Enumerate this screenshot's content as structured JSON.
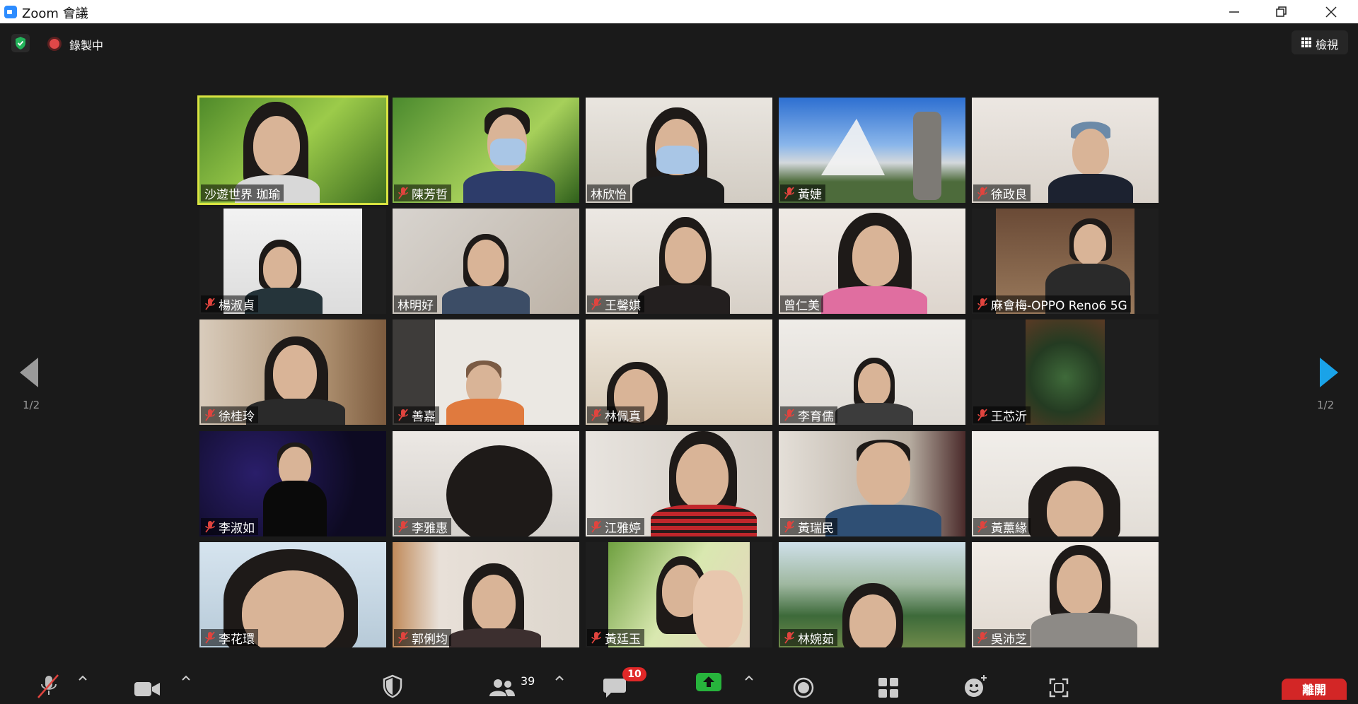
{
  "window": {
    "title": "Zoom 會議"
  },
  "topbar": {
    "recording_label": "錄製中",
    "view_label": "檢視"
  },
  "pagination": {
    "left": "1/2",
    "right": "1/2"
  },
  "participants": [
    {
      "name": "沙遊世界 珈瑜",
      "muted": false,
      "active": true
    },
    {
      "name": "陳芳哲",
      "muted": true,
      "active": false
    },
    {
      "name": "林欣怡",
      "muted": false,
      "active": false
    },
    {
      "name": "黃婕",
      "muted": true,
      "active": false
    },
    {
      "name": "徐政良",
      "muted": true,
      "active": false
    },
    {
      "name": "楊淑貞",
      "muted": true,
      "active": false
    },
    {
      "name": "林明好",
      "muted": false,
      "active": false
    },
    {
      "name": "王馨娸",
      "muted": true,
      "active": false
    },
    {
      "name": "曾仁美",
      "muted": false,
      "active": false
    },
    {
      "name": "麻會梅-OPPO Reno6 5G",
      "muted": true,
      "active": false
    },
    {
      "name": "徐桂玲",
      "muted": true,
      "active": false
    },
    {
      "name": "善嘉",
      "muted": true,
      "active": false
    },
    {
      "name": "林佩真",
      "muted": true,
      "active": false
    },
    {
      "name": "李育儒",
      "muted": true,
      "active": false
    },
    {
      "name": "王芯沂",
      "muted": true,
      "active": false
    },
    {
      "name": "李淑如",
      "muted": true,
      "active": false
    },
    {
      "name": "李雅惠",
      "muted": true,
      "active": false
    },
    {
      "name": "江雅婷",
      "muted": true,
      "active": false
    },
    {
      "name": "黃瑞民",
      "muted": true,
      "active": false
    },
    {
      "name": "黃薰緣",
      "muted": true,
      "active": false
    },
    {
      "name": "李花環",
      "muted": true,
      "active": false
    },
    {
      "name": "郭俐均",
      "muted": true,
      "active": false
    },
    {
      "name": "黃廷玉",
      "muted": true,
      "active": false
    },
    {
      "name": "林婉茹",
      "muted": true,
      "active": false
    },
    {
      "name": "吳沛芝",
      "muted": true,
      "active": false
    }
  ],
  "toolbar": {
    "participants_count": "39",
    "chat_badge": "10",
    "leave_label": "離開"
  },
  "colors": {
    "active_speaker": "#d9e441",
    "mute_red": "#e0443e",
    "share_green": "#27b43c",
    "leave_red": "#d32626",
    "nav_arrow_blue": "#1aa3e8"
  }
}
